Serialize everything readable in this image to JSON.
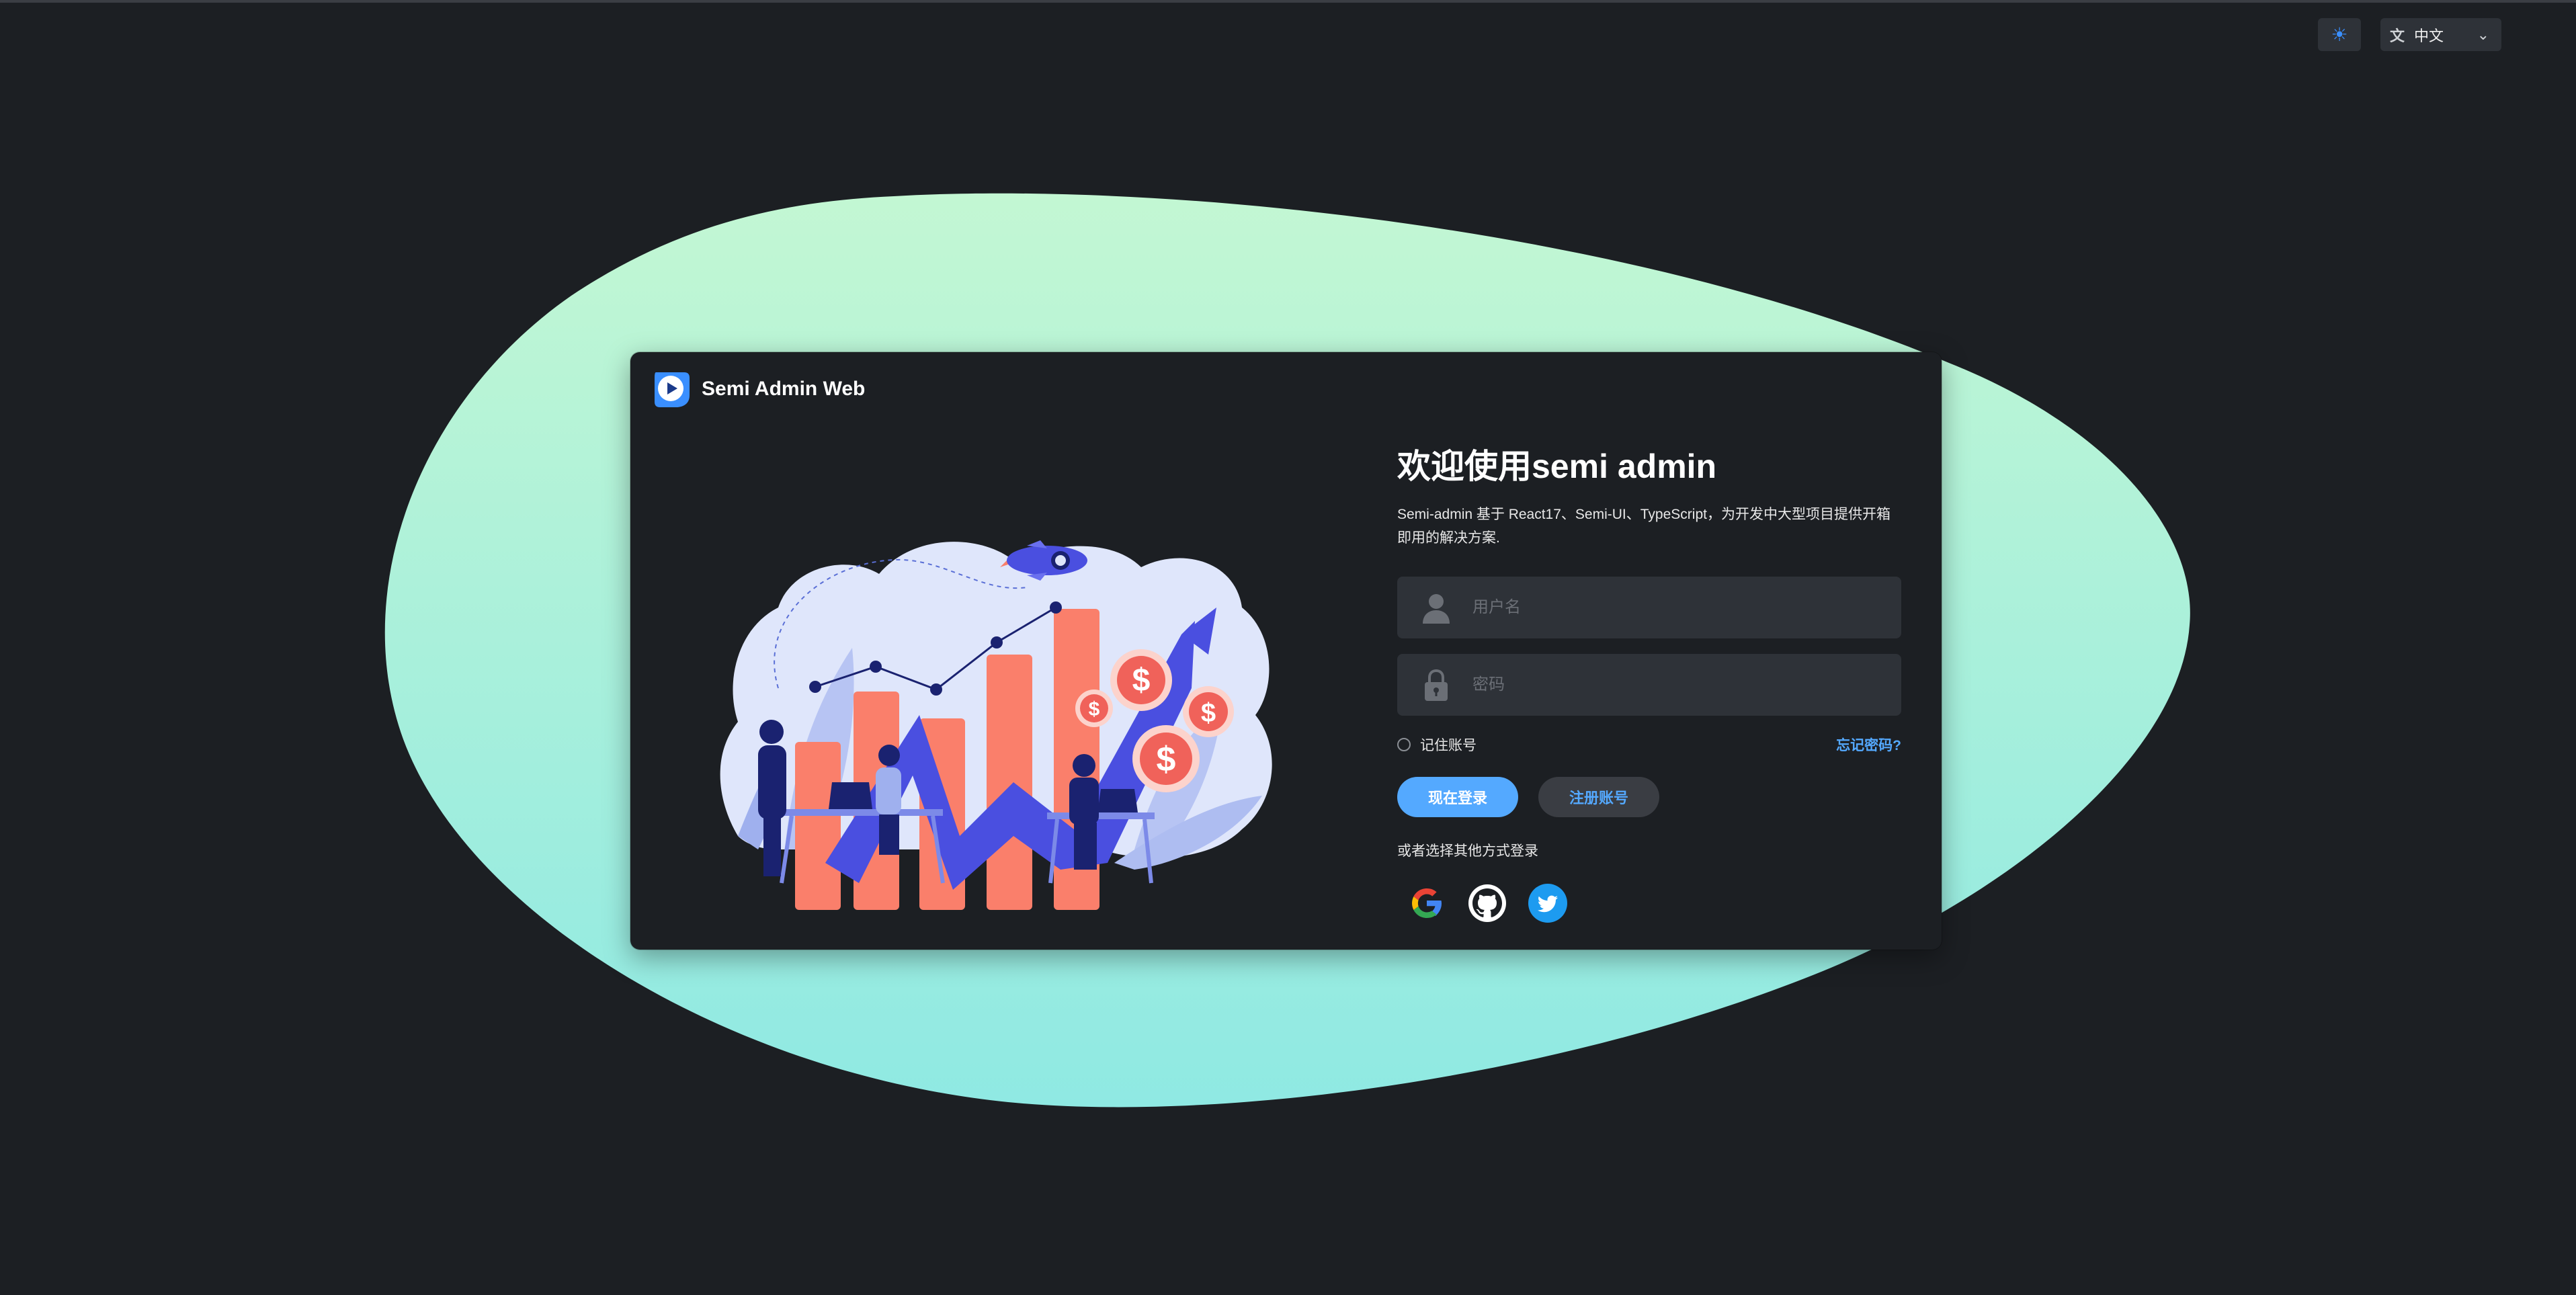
{
  "header": {
    "theme_icon": "sun-icon",
    "language_icon": "translate-icon",
    "language_selected": "中文",
    "chevron_icon": "chevron-down-icon"
  },
  "brand": {
    "name": "Semi Admin Web",
    "logo_icon": "play-logo-icon"
  },
  "login": {
    "title": "欢迎使用semi admin",
    "description": "Semi-admin 基于 React17、Semi-UI、TypeScript，为开发中大型项目提供开箱即用的解决方案.",
    "username_placeholder": "用户名",
    "password_placeholder": "密码",
    "remember_label": "记住账号",
    "forgot_label": "忘记密码?",
    "login_button": "现在登录",
    "register_button": "注册账号",
    "alt_login_text": "或者选择其他方式登录",
    "social": [
      "google-icon",
      "github-icon",
      "twitter-icon"
    ]
  },
  "colors": {
    "background": "#1c1f23",
    "card": "#1c1f23",
    "primary": "#54a9ff",
    "blob_top": "#c3f7d3",
    "blob_bottom": "#8fe9e3"
  }
}
